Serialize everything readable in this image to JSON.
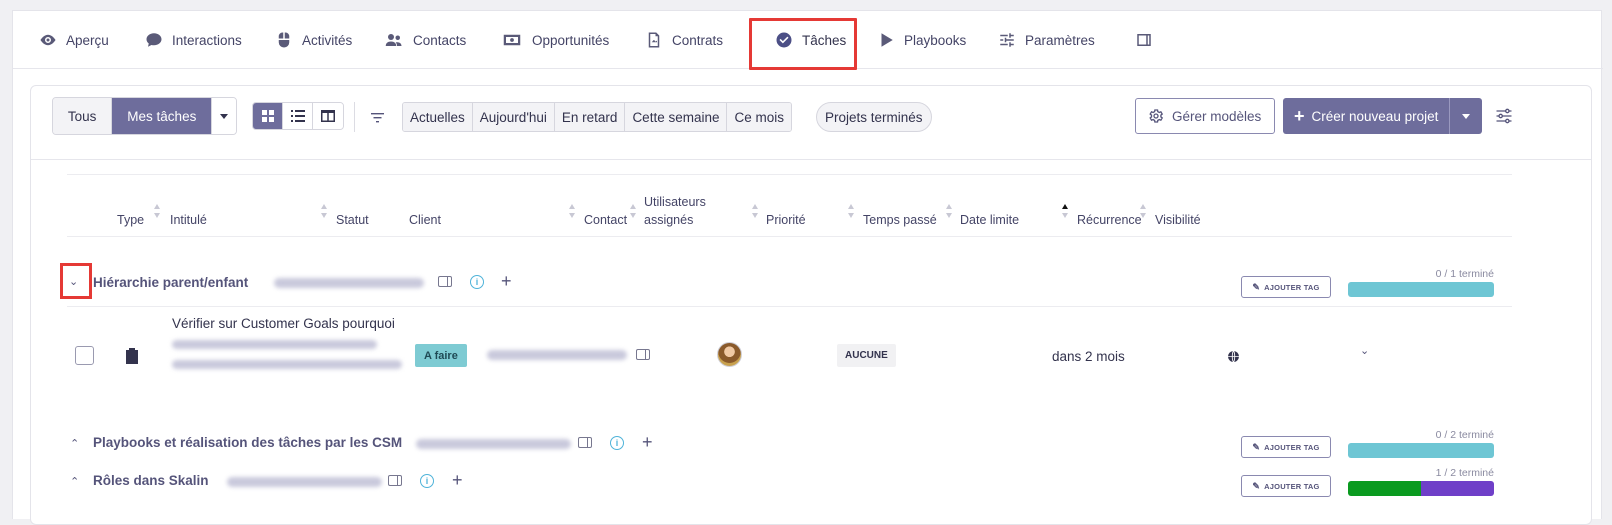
{
  "nav": {
    "items": [
      {
        "label": "Aperçu",
        "icon": "eye-icon"
      },
      {
        "label": "Interactions",
        "icon": "chat-bubble-icon"
      },
      {
        "label": "Activités",
        "icon": "mouse-icon"
      },
      {
        "label": "Contacts",
        "icon": "users-icon"
      },
      {
        "label": "Opportunités",
        "icon": "money-icon"
      },
      {
        "label": "Contrats",
        "icon": "contract-icon"
      },
      {
        "label": "Tâches",
        "icon": "check-circle-icon"
      },
      {
        "label": "Playbooks",
        "icon": "play-icon"
      },
      {
        "label": "Paramètres",
        "icon": "sliders-icon"
      }
    ],
    "active": "Tâches"
  },
  "toolbar": {
    "scope": [
      "Tous",
      "Mes tâches"
    ],
    "scope_active": "Mes tâches",
    "filters": [
      "Actuelles",
      "Aujourd'hui",
      "En retard",
      "Cette semaine",
      "Ce mois"
    ],
    "completed_projects": "Projets terminés",
    "manage_templates": "Gérer modèles",
    "create_project": "Créer nouveau projet"
  },
  "columns": {
    "type": "Type",
    "title": "Intitulé",
    "status": "Statut",
    "client": "Client",
    "contact": "Contact",
    "assigned_line1": "Utilisateurs",
    "assigned_line2": "assignés",
    "priority": "Priorité",
    "time_spent": "Temps passé",
    "due_date": "Date limite",
    "recurrence": "Récurrence",
    "visibility": "Visibilité"
  },
  "groups": [
    {
      "title": "Hiérarchie parent/enfant",
      "expanded": true,
      "tag_label": "AJOUTER TAG",
      "progress_label": "0 / 1 terminé",
      "progress": {
        "done": 0,
        "total": 1
      },
      "tasks": [
        {
          "title": "Vérifier sur Customer Goals pourquoi",
          "status": "A faire",
          "priority": "AUCUNE",
          "due": "dans 2 mois"
        }
      ]
    },
    {
      "title": "Playbooks et réalisation des tâches par les CSM",
      "expanded": false,
      "tag_label": "AJOUTER TAG",
      "progress_label": "0 / 2 terminé",
      "progress": {
        "done": 0,
        "total": 2
      }
    },
    {
      "title": "Rôles dans Skalin",
      "expanded": false,
      "tag_label": "AJOUTER TAG",
      "progress_label": "1 / 2 terminé",
      "progress": {
        "done": 1,
        "total": 2
      }
    }
  ],
  "colors": {
    "accent": "#6e6d9c",
    "progress_empty": "#6ec6d4",
    "progress_done": "#0a9a1f",
    "progress_rest": "#6f3fc8",
    "highlight": "#e53935",
    "status_todo": "#7ecbd3"
  }
}
